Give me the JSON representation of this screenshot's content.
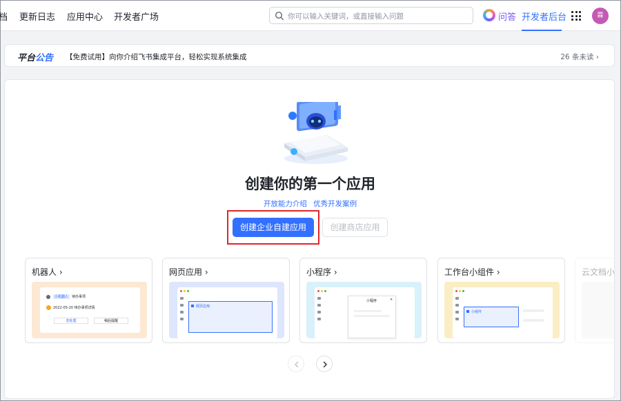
{
  "nav": {
    "items": [
      "档",
      "更新日志",
      "应用中心",
      "开发者广场"
    ],
    "search_placeholder": "你可以输入关键词，或直接输入问题",
    "qa_label": "问答",
    "dev_console": "开发者后台",
    "avatar_text": "霖"
  },
  "notice": {
    "brand_part1": "平台",
    "brand_part2": "公告",
    "message": "【免费试用】向你介绍飞书集成平台，轻松实现系统集成",
    "unread": "26 条未读 ›"
  },
  "main": {
    "headline": "创建你的第一个应用",
    "link_capabilities": "开放能力介绍",
    "link_cases": "优秀开发案例",
    "create_custom_app": "创建企业自建应用",
    "create_store_app": "创建商店应用"
  },
  "app_types": [
    {
      "title": "机器人 ›",
      "preview": {
        "bot_tag": "小机器人",
        "task": "待办事项",
        "detail": "2022-05-20 待办事项详情",
        "btn_confirm": "去处理",
        "btn_later": "稍后提醒"
      }
    },
    {
      "title": "网页应用 ›",
      "preview": {
        "tab": "网页应用"
      }
    },
    {
      "title": "小程序 ›",
      "preview": {
        "window_title": "小程序"
      }
    },
    {
      "title": "工作台小组件 ›",
      "preview": {
        "widget": "小组件"
      }
    },
    {
      "title": "云文档小组件 ›"
    }
  ],
  "colors": {
    "accent": "#3370ff",
    "highlight_box": "#e0242b",
    "avatar": "#c45ab4"
  }
}
